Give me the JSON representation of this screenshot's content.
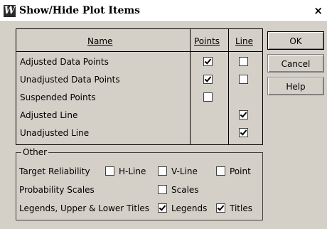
{
  "window": {
    "title": "Show/Hide Plot Items",
    "close": "×",
    "app_icon": "W"
  },
  "table": {
    "headers": {
      "name": "Name",
      "points": "Points",
      "line": "Line"
    },
    "rows": [
      {
        "label": "Adjusted Data Points",
        "points": true,
        "line": false,
        "has_points": true,
        "has_line": true
      },
      {
        "label": "Unadjusted Data Points",
        "points": true,
        "line": false,
        "has_points": true,
        "has_line": true
      },
      {
        "label": "Suspended Points",
        "points": false,
        "has_points": true,
        "has_line": false
      },
      {
        "label": "Adjusted Line",
        "line": true,
        "has_points": false,
        "has_line": true
      },
      {
        "label": "Unadjusted Line",
        "line": true,
        "has_points": false,
        "has_line": true
      }
    ]
  },
  "buttons": {
    "ok": "OK",
    "cancel": "Cancel",
    "help": "Help"
  },
  "other": {
    "title": "Other",
    "target_reliability": {
      "label": "Target Reliability",
      "hline": "H-Line",
      "vline": "V-Line",
      "point": "Point",
      "hline_checked": false,
      "vline_checked": false,
      "point_checked": false
    },
    "probability_scales": {
      "label": "Probability Scales",
      "scales": "Scales",
      "scales_checked": false
    },
    "legends": {
      "label": "Legends, Upper & Lower Titles",
      "legends": "Legends",
      "titles": "Titles",
      "legends_checked": true,
      "titles_checked": true
    }
  }
}
